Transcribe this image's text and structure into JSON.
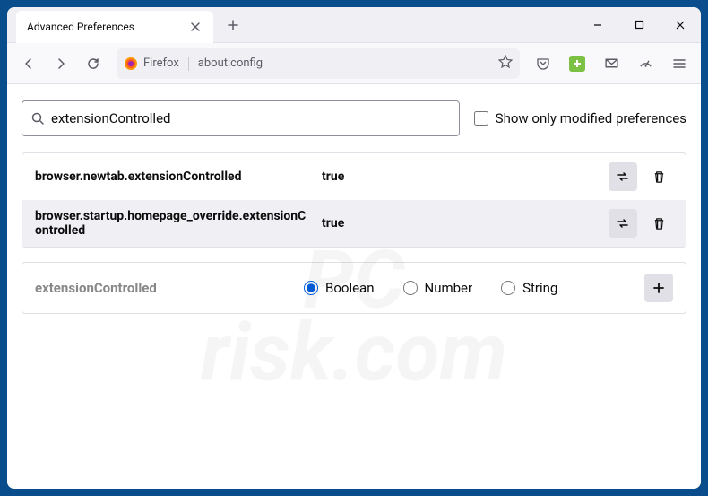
{
  "window": {
    "tab_title": "Advanced Preferences",
    "identity_label": "Firefox",
    "url": "about:config"
  },
  "search": {
    "placeholder": "",
    "value": "extensionControlled",
    "checkbox_label": "Show only modified preferences"
  },
  "prefs": [
    {
      "name": "browser.newtab.extensionControlled",
      "value": "true"
    },
    {
      "name": "browser.startup.homepage_override.extensionControlled",
      "value": "true"
    }
  ],
  "add": {
    "name": "extensionControlled",
    "options": [
      "Boolean",
      "Number",
      "String"
    ],
    "selected": "Boolean"
  },
  "watermark": {
    "line1": "PC",
    "line2": "risk.com"
  }
}
